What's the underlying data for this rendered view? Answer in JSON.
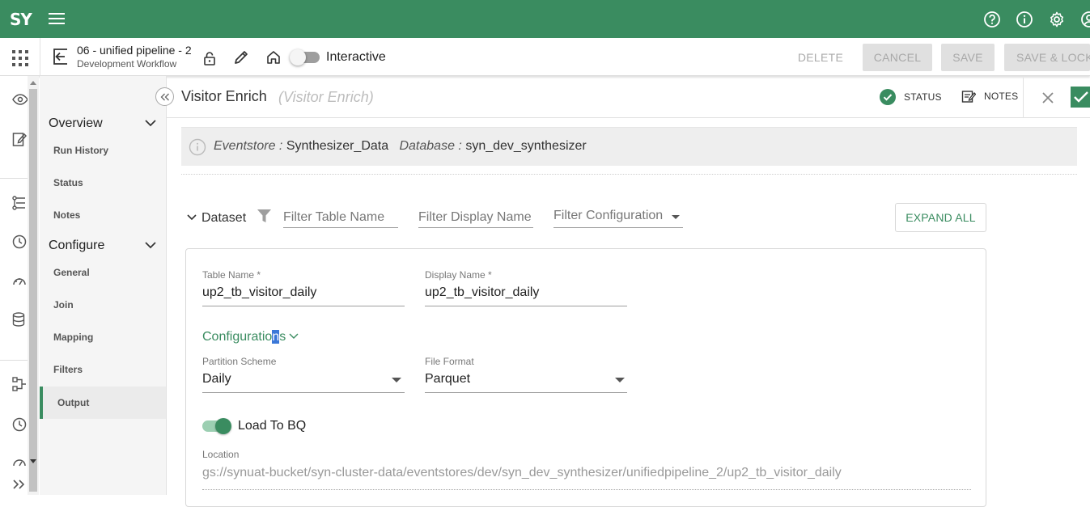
{
  "app": {
    "logo": "SY",
    "icons": [
      "menu-icon",
      "help-icon",
      "info-icon",
      "settings-icon",
      "user-icon"
    ]
  },
  "pipeline": {
    "title": "06 - unified pipeline - 2",
    "subtitle": "Development Workflow",
    "mode_label": "Interactive",
    "mode_on": false
  },
  "toolbar": {
    "delete": "DELETE",
    "cancel": "CANCEL",
    "save": "SAVE",
    "save_lock": "SAVE & LOCK"
  },
  "menu": {
    "overview": "Overview",
    "overview_items": [
      "Run History",
      "Status",
      "Notes"
    ],
    "configure": "Configure",
    "configure_items": [
      "General",
      "Join",
      "Mapping",
      "Filters"
    ],
    "active_item": "Output"
  },
  "section": {
    "title": "Visitor Enrich",
    "subtitle": "(Visitor Enrich)",
    "status_label": "STATUS",
    "notes_label": "NOTES"
  },
  "info": {
    "eventstore_key": "Eventstore :",
    "eventstore_val": "Synthesizer_Data",
    "database_key": "Database :",
    "database_val": "syn_dev_synthesizer"
  },
  "dataset": {
    "label": "Dataset",
    "filter_table_placeholder": "Filter Table Name",
    "filter_display_placeholder": "Filter Display Name",
    "filter_config_placeholder": "Filter Configuration",
    "expand_all": "EXPAND ALL"
  },
  "card": {
    "table_name_label": "Table Name *",
    "table_name_value": "up2_tb_visitor_daily",
    "display_name_label": "Display Name *",
    "display_name_value": "up2_tb_visitor_daily",
    "configurations_pre": "Configuratio",
    "configurations_sel": "n",
    "configurations_post": "s",
    "partition_label": "Partition Scheme",
    "partition_value": "Daily",
    "format_label": "File Format",
    "format_value": "Parquet",
    "load_bq_label": "Load To BQ",
    "load_bq_on": true,
    "location_label": "Location",
    "location_value": "gs://synuat-bucket/syn-cluster-data/eventstores/dev/syn_dev_synthesizer/unifiedpipeline_2/up2_tb_visitor_daily"
  },
  "colors": {
    "brand": "#3a8c60",
    "selection": "#3b78d8"
  }
}
